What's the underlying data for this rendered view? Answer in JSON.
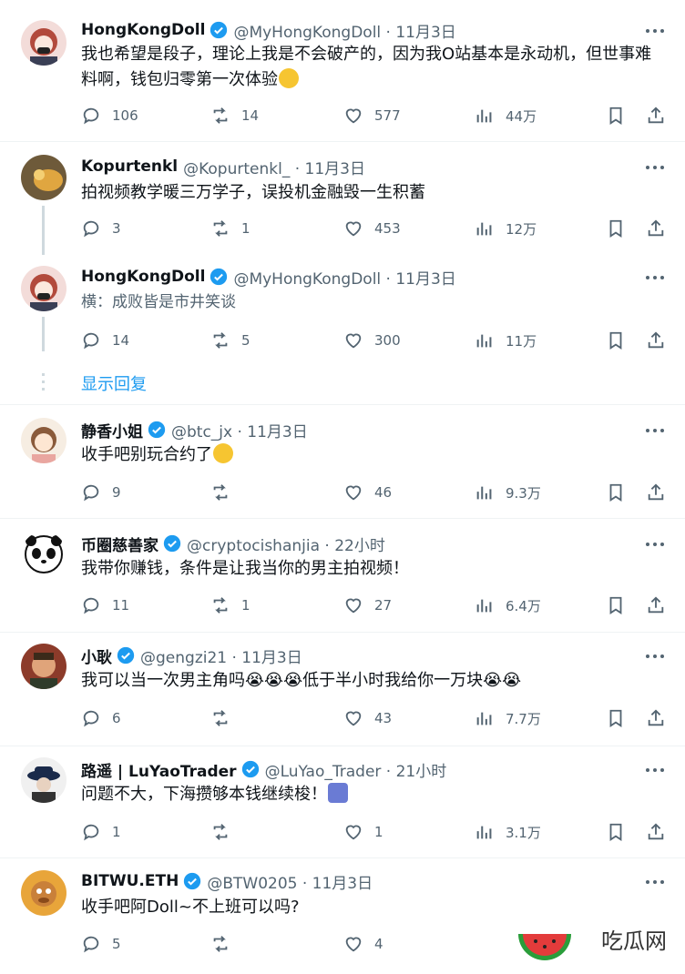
{
  "tweets": [
    {
      "name": "HongKongDoll",
      "handle": "@MyHongKongDoll · 11月3日",
      "text": "我也希望是段子，理论上我是不会破产的，因为我O站基本是永动机，但世事难料啊，钱包归零第一次体验",
      "emoji": "😢",
      "replies": "106",
      "retweets": "14",
      "likes": "577",
      "views": "44万",
      "verified": true
    },
    {
      "name": "Kopurtenkl",
      "handle": "@Kopurtenkl_ · 11月3日",
      "text": "拍视频教学暖三万学子，误投机金融毁一生积蓄",
      "emoji": "",
      "replies": "3",
      "retweets": "1",
      "likes": "453",
      "views": "12万",
      "verified": false
    },
    {
      "name": "HongKongDoll",
      "handle": "@MyHongKongDoll · 11月3日",
      "text": "横：成败皆是市井笑谈",
      "emoji": "",
      "replies": "14",
      "retweets": "5",
      "likes": "300",
      "views": "11万",
      "verified": true
    },
    {
      "name": "静香小姐",
      "handle": "@btc_jx · 11月3日",
      "text": "收手吧别玩合约了",
      "emoji": "😢",
      "replies": "9",
      "retweets": "",
      "likes": "46",
      "views": "9.3万",
      "verified": true
    },
    {
      "name": "币圈慈善家",
      "handle": "@cryptocishanjia · 22小时",
      "text": "我带你赚钱，条件是让我当你的男主拍视频！",
      "emoji": "",
      "replies": "11",
      "retweets": "1",
      "likes": "27",
      "views": "6.4万",
      "verified": true
    },
    {
      "name": "小耿",
      "handle": "@gengzi21 · 11月3日",
      "text": "我可以当一次男主角吗😭😭😭低于半小时我给你一万块😭😭",
      "emoji": "",
      "replies": "6",
      "retweets": "",
      "likes": "43",
      "views": "7.7万",
      "verified": true
    },
    {
      "name": "路遥 | LuYaoTrader",
      "handle": "@LuYao_Trader · 21小时",
      "text": "问题不大，下海攒够本钱继续梭！",
      "emoji": "🧙",
      "replies": "1",
      "retweets": "",
      "likes": "1",
      "views": "3.1万",
      "verified": true
    },
    {
      "name": "BITWU.ETH",
      "handle": "@BTW0205 · 11月3日",
      "text": "收手吧阿Doll~不上班可以吗?",
      "emoji": "",
      "replies": "5",
      "retweets": "",
      "likes": "4",
      "views": "",
      "verified": true
    }
  ],
  "show_replies_label": "显示回复",
  "watermark": "吃瓜网",
  "colors": {
    "accent": "#1d9bf0",
    "text": "#0f1419",
    "muted": "#536471",
    "separator": "#eff3f4"
  }
}
